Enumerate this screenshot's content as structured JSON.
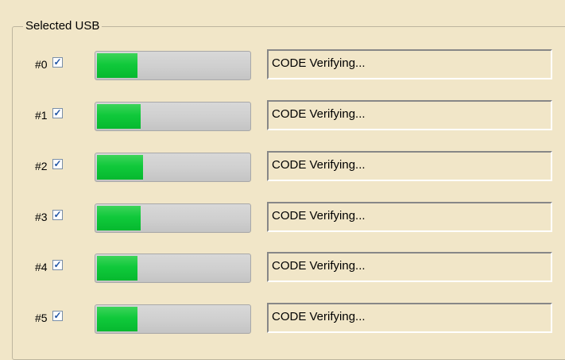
{
  "group": {
    "title": "Selected USB"
  },
  "usb_slots": [
    {
      "label": "#0",
      "checked": true,
      "progress": 0.28,
      "status": "CODE Verifying..."
    },
    {
      "label": "#1",
      "checked": true,
      "progress": 0.3,
      "status": "CODE Verifying..."
    },
    {
      "label": "#2",
      "checked": true,
      "progress": 0.32,
      "status": "CODE Verifying..."
    },
    {
      "label": "#3",
      "checked": true,
      "progress": 0.3,
      "status": "CODE Verifying..."
    },
    {
      "label": "#4",
      "checked": true,
      "progress": 0.28,
      "status": "CODE Verifying..."
    },
    {
      "label": "#5",
      "checked": true,
      "progress": 0.28,
      "status": "CODE Verifying..."
    }
  ],
  "colors": {
    "background": "#f1e6c8",
    "progress_fill": "#10c93b",
    "progress_track": "#cfcfcf",
    "checkbox_mark": "#2256a5"
  },
  "icons": {
    "check": "checkmark-icon"
  }
}
